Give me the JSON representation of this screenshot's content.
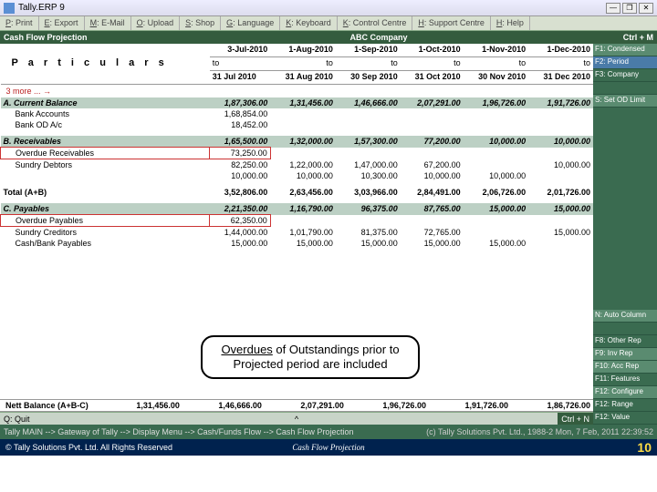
{
  "title": "Tally.ERP 9",
  "menu": [
    {
      "k": "P",
      "l": ": Print"
    },
    {
      "k": "E",
      "l": ": Export"
    },
    {
      "k": "M",
      "l": ": E-Mail"
    },
    {
      "k": "O",
      "l": ": Upload"
    },
    {
      "k": "S",
      "l": ": Shop"
    },
    {
      "k": "G",
      "l": ": Language"
    },
    {
      "k": "K",
      "l": ": Keyboard"
    },
    {
      "k": "K",
      "l": ": Control Centre"
    },
    {
      "k": "H",
      "l": ": Support Centre"
    },
    {
      "k": "H",
      "l": ": Help"
    }
  ],
  "sub": {
    "left": "Cash Flow Projection",
    "center": "ABC Company",
    "right": "Ctrl + M"
  },
  "sidebar": [
    {
      "l": "F1: Condensed",
      "c": "light"
    },
    {
      "l": "F2: Period",
      "c": "blue"
    },
    {
      "l": "F3: Company",
      "c": "dark"
    },
    {
      "l": "",
      "c": "dark"
    },
    {
      "l": "S: Set OD Limit",
      "c": "light"
    }
  ],
  "sidebar2": [
    {
      "l": "N: Auto Column",
      "c": "light"
    },
    {
      "l": "",
      "c": "dark"
    },
    {
      "l": "F8: Other Rep",
      "c": "dark"
    },
    {
      "l": "F9: Inv Rep",
      "c": "light"
    },
    {
      "l": "F10: Acc Rep",
      "c": "light"
    },
    {
      "l": "F11: Features",
      "c": "dark"
    },
    {
      "l": "F12: Configure",
      "c": "light"
    },
    {
      "l": "F12: Range",
      "c": "dark"
    },
    {
      "l": "F12: Value",
      "c": "dark"
    }
  ],
  "cols": [
    {
      "t": "3-Jul-2010",
      "b": "31 Jul 2010"
    },
    {
      "t": "1-Aug-2010",
      "b": "31 Aug 2010"
    },
    {
      "t": "1-Sep-2010",
      "b": "30 Sep 2010"
    },
    {
      "t": "1-Oct-2010",
      "b": "31 Oct 2010"
    },
    {
      "t": "1-Nov-2010",
      "b": "30 Nov 2010"
    },
    {
      "t": "1-Dec-2010",
      "b": "31 Dec 2010"
    }
  ],
  "more": "3 more ... →",
  "rows": [
    {
      "t": "head",
      "l": "A. Current Balance",
      "v": [
        "1,87,306.00",
        "1,31,456.00",
        "1,46,666.00",
        "2,07,291.00",
        "1,96,726.00",
        "1,91,726.00"
      ]
    },
    {
      "t": "sub",
      "l": "Bank Accounts",
      "v": [
        "1,68,854.00",
        "",
        "",
        "",
        "",
        ""
      ]
    },
    {
      "t": "sub",
      "l": "Bank OD A/c",
      "v": [
        "18,452.00",
        "",
        "",
        "",
        "",
        ""
      ]
    },
    {
      "t": "spacer"
    },
    {
      "t": "head",
      "l": "B. Receivables",
      "v": [
        "1,65,500.00",
        "1,32,000.00",
        "1,57,300.00",
        "77,200.00",
        "10,000.00",
        "10,000.00"
      ]
    },
    {
      "t": "sub red",
      "l": "Overdue Receivables",
      "v": [
        "73,250.00",
        "",
        "",
        "",
        "",
        ""
      ]
    },
    {
      "t": "sub",
      "l": "Sundry Debtors",
      "v": [
        "82,250.00",
        "1,22,000.00",
        "1,47,000.00",
        "67,200.00",
        "",
        "10,000.00"
      ]
    },
    {
      "t": "sub",
      "l": "",
      "v": [
        "10,000.00",
        "10,000.00",
        "10,300.00",
        "10,000.00",
        "10,000.00",
        ""
      ]
    },
    {
      "t": "spacer"
    },
    {
      "t": "bold",
      "l": "Total (A+B)",
      "v": [
        "3,52,806.00",
        "2,63,456.00",
        "3,03,966.00",
        "2,84,491.00",
        "2,06,726.00",
        "2,01,726.00"
      ]
    },
    {
      "t": "spacer"
    },
    {
      "t": "head",
      "l": "C. Payables",
      "v": [
        "2,21,350.00",
        "1,16,790.00",
        "96,375.00",
        "87,765.00",
        "15,000.00",
        "15,000.00"
      ]
    },
    {
      "t": "sub red",
      "l": "Overdue Payables",
      "v": [
        "62,350.00",
        "",
        "",
        "",
        "",
        ""
      ]
    },
    {
      "t": "sub",
      "l": "Sundry Creditors",
      "v": [
        "1,44,000.00",
        "1,01,790.00",
        "81,375.00",
        "72,765.00",
        "",
        "15,000.00"
      ]
    },
    {
      "t": "sub",
      "l": "Cash/Bank Payables",
      "v": [
        "15,000.00",
        "15,000.00",
        "15,000.00",
        "15,000.00",
        "15,000.00",
        ""
      ]
    }
  ],
  "nett": {
    "l": "Nett Balance (A+B-C)",
    "v": [
      "1,31,456.00",
      "1,46,666.00",
      "2,07,291.00",
      "1,96,726.00",
      "1,91,726.00",
      "1,86,726.00"
    ]
  },
  "callout": {
    "a": "Overdues",
    "b": " of Outstandings prior to Projected period are included"
  },
  "botq": "Q: Quit",
  "botctrl": "Ctrl + N",
  "bc": {
    "l": "Tally MAIN --> Gateway of Tally --> Display Menu --> Cash/Funds Flow --> Cash Flow Projection",
    "r": "(c) Tally Solutions Pvt. Ltd., 1988-2  Mon, 7 Feb, 2011  22:39:52"
  },
  "foot": {
    "l": "© Tally Solutions Pvt. Ltd. All Rights Reserved",
    "c": "Cash Flow Projection",
    "p": "10"
  }
}
